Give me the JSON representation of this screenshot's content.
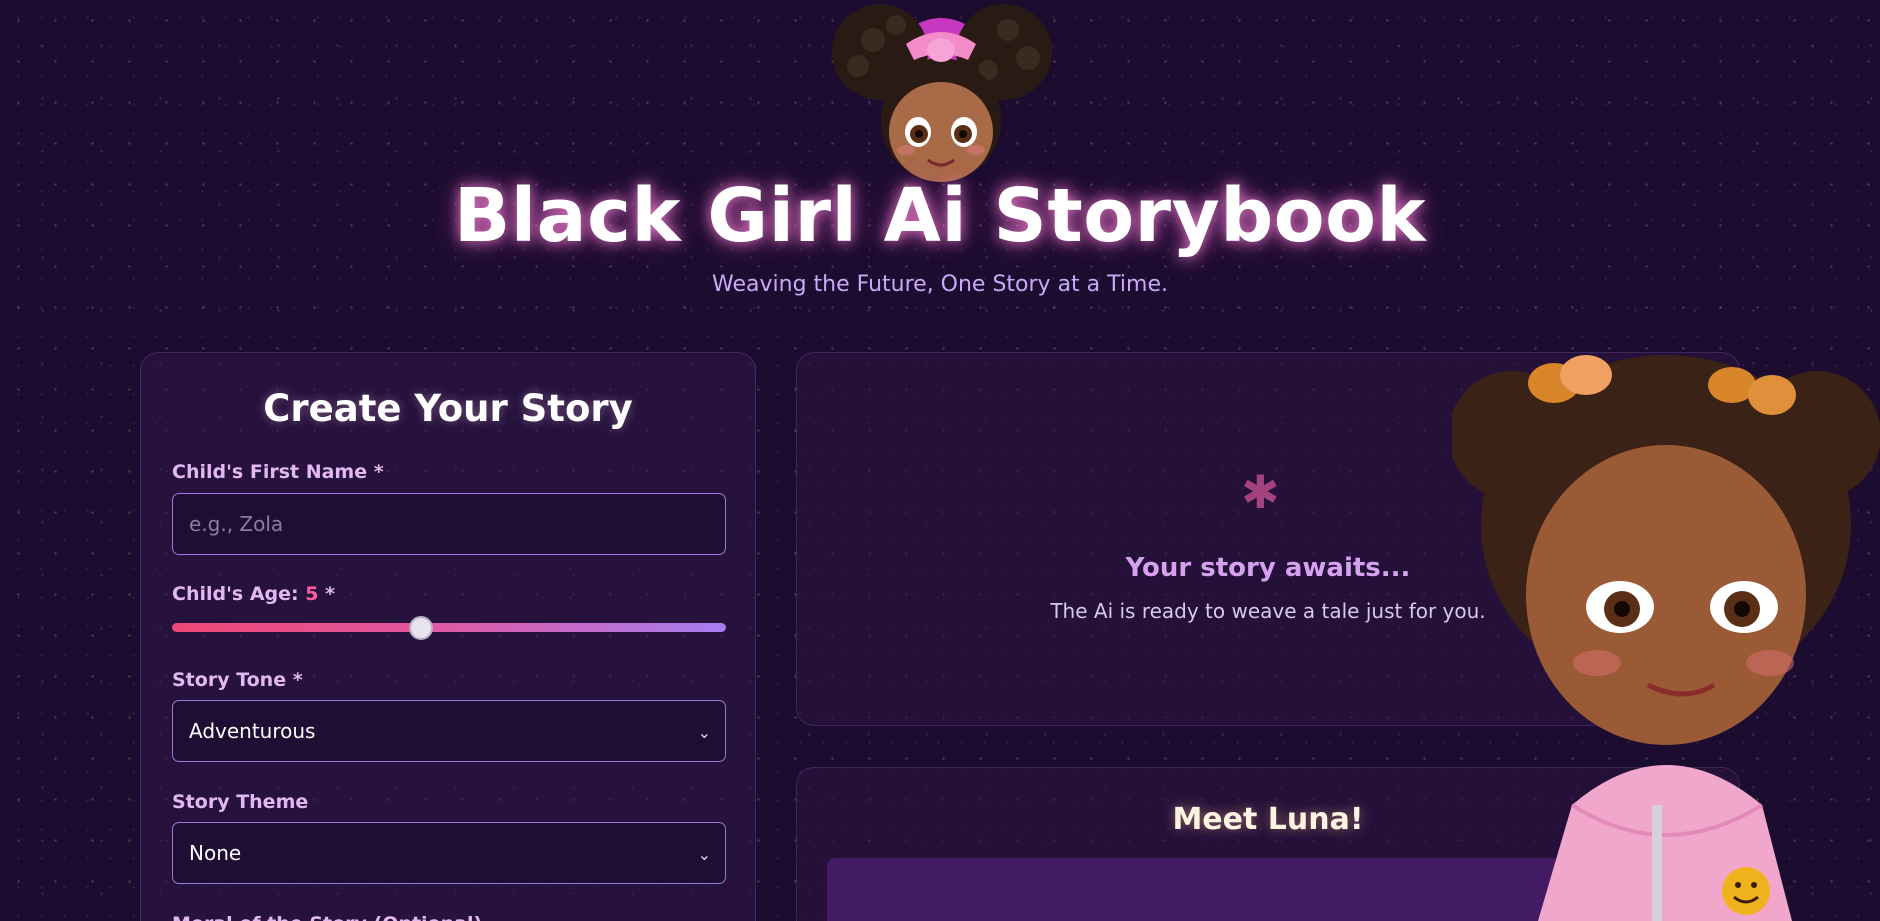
{
  "header": {
    "title": "Black Girl Ai Storybook",
    "subtitle": "Weaving the Future, One Story at a Time."
  },
  "form": {
    "title": "Create Your Story",
    "name_label": "Child's First Name *",
    "name_placeholder": "e.g., Zola",
    "name_value": "",
    "age_label": "Child's Age:",
    "age_value": "5",
    "age_required": " *",
    "age_fraction": 0.45,
    "tone_label": "Story Tone *",
    "tone_value": "Adventurous",
    "theme_label": "Story Theme",
    "theme_value": "None",
    "moral_label": "Moral of the Story (Optional)"
  },
  "story_panel": {
    "icon": "sparkle-icon",
    "title": "Your story awaits...",
    "text": "The Ai is ready to weave a tale just for you."
  },
  "luna": {
    "title": "Meet Luna!"
  },
  "colors": {
    "background": "#1c0c30",
    "accent_pink": "#ff5d9e",
    "label_lavender": "#e2b8f2",
    "input_border": "#9a7ad8"
  }
}
